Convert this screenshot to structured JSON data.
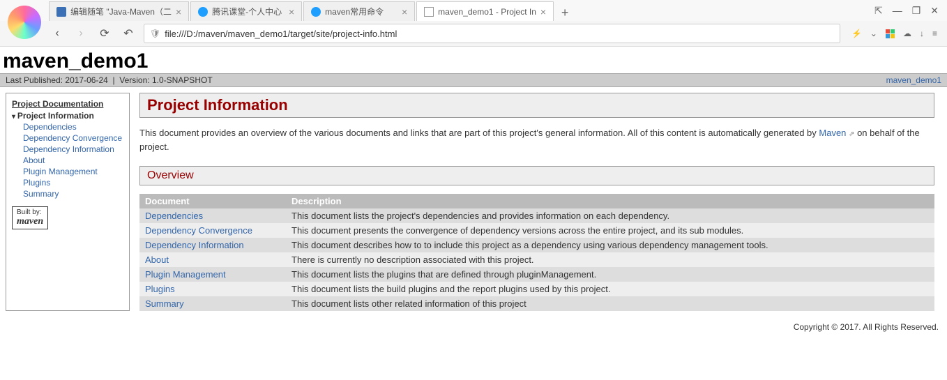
{
  "browser": {
    "tabs": [
      {
        "label": "编辑随笔 \"Java-Maven（二",
        "icon_color": "#3b6fb6"
      },
      {
        "label": "腾讯课堂-个人中心",
        "icon_color": "#1e9fff"
      },
      {
        "label": "maven常用命令",
        "icon_color": "#1e9fff"
      },
      {
        "label": "maven_demo1 - Project In",
        "icon_color": "#cccccc",
        "active": true
      }
    ],
    "window_controls": {
      "pin": "⇱",
      "min": "—",
      "restore": "❐",
      "close": "✕"
    },
    "nav": {
      "back": "‹",
      "forward": "›",
      "reload": "⟳",
      "home": "↶"
    },
    "url": "file:///D:/maven/maven_demo1/target/site/project-info.html",
    "right_icons": {
      "flash": "⚡",
      "dropdown": "⌄",
      "cloud": "☁",
      "download": "↓",
      "menu": "≡"
    }
  },
  "banner": {
    "title": "maven_demo1"
  },
  "breadcrumbs": {
    "last_published_label": "Last Published:",
    "last_published": "2017-06-24",
    "version_label": "Version:",
    "version": "1.0-SNAPSHOT",
    "right_link": "maven_demo1"
  },
  "sidebar": {
    "heading": "Project Documentation",
    "current": "Project Information",
    "items": [
      "Dependencies",
      "Dependency Convergence",
      "Dependency Information",
      "About",
      "Plugin Management",
      "Plugins",
      "Summary"
    ],
    "badge_built_by": "Built by:",
    "badge_maven": "maven"
  },
  "main": {
    "title": "Project Information",
    "intro_pre": "This document provides an overview of the various documents and links that are part of this project's general information. All of this content is automatically generated by ",
    "intro_link": "Maven",
    "intro_post": " on behalf of the project.",
    "overview_title": "Overview",
    "table_headers": {
      "doc": "Document",
      "desc": "Description"
    },
    "rows": [
      {
        "doc": "Dependencies",
        "desc": "This document lists the project's dependencies and provides information on each dependency."
      },
      {
        "doc": "Dependency Convergence",
        "desc": "This document presents the convergence of dependency versions across the entire project, and its sub modules."
      },
      {
        "doc": "Dependency Information",
        "desc": "This document describes how to to include this project as a dependency using various dependency management tools."
      },
      {
        "doc": "About",
        "desc": "There is currently no description associated with this project."
      },
      {
        "doc": "Plugin Management",
        "desc": "This document lists the plugins that are defined through pluginManagement."
      },
      {
        "doc": "Plugins",
        "desc": "This document lists the build plugins and the report plugins used by this project."
      },
      {
        "doc": "Summary",
        "desc": "This document lists other related information of this project"
      }
    ]
  },
  "footer": "Copyright © 2017. All Rights Reserved."
}
